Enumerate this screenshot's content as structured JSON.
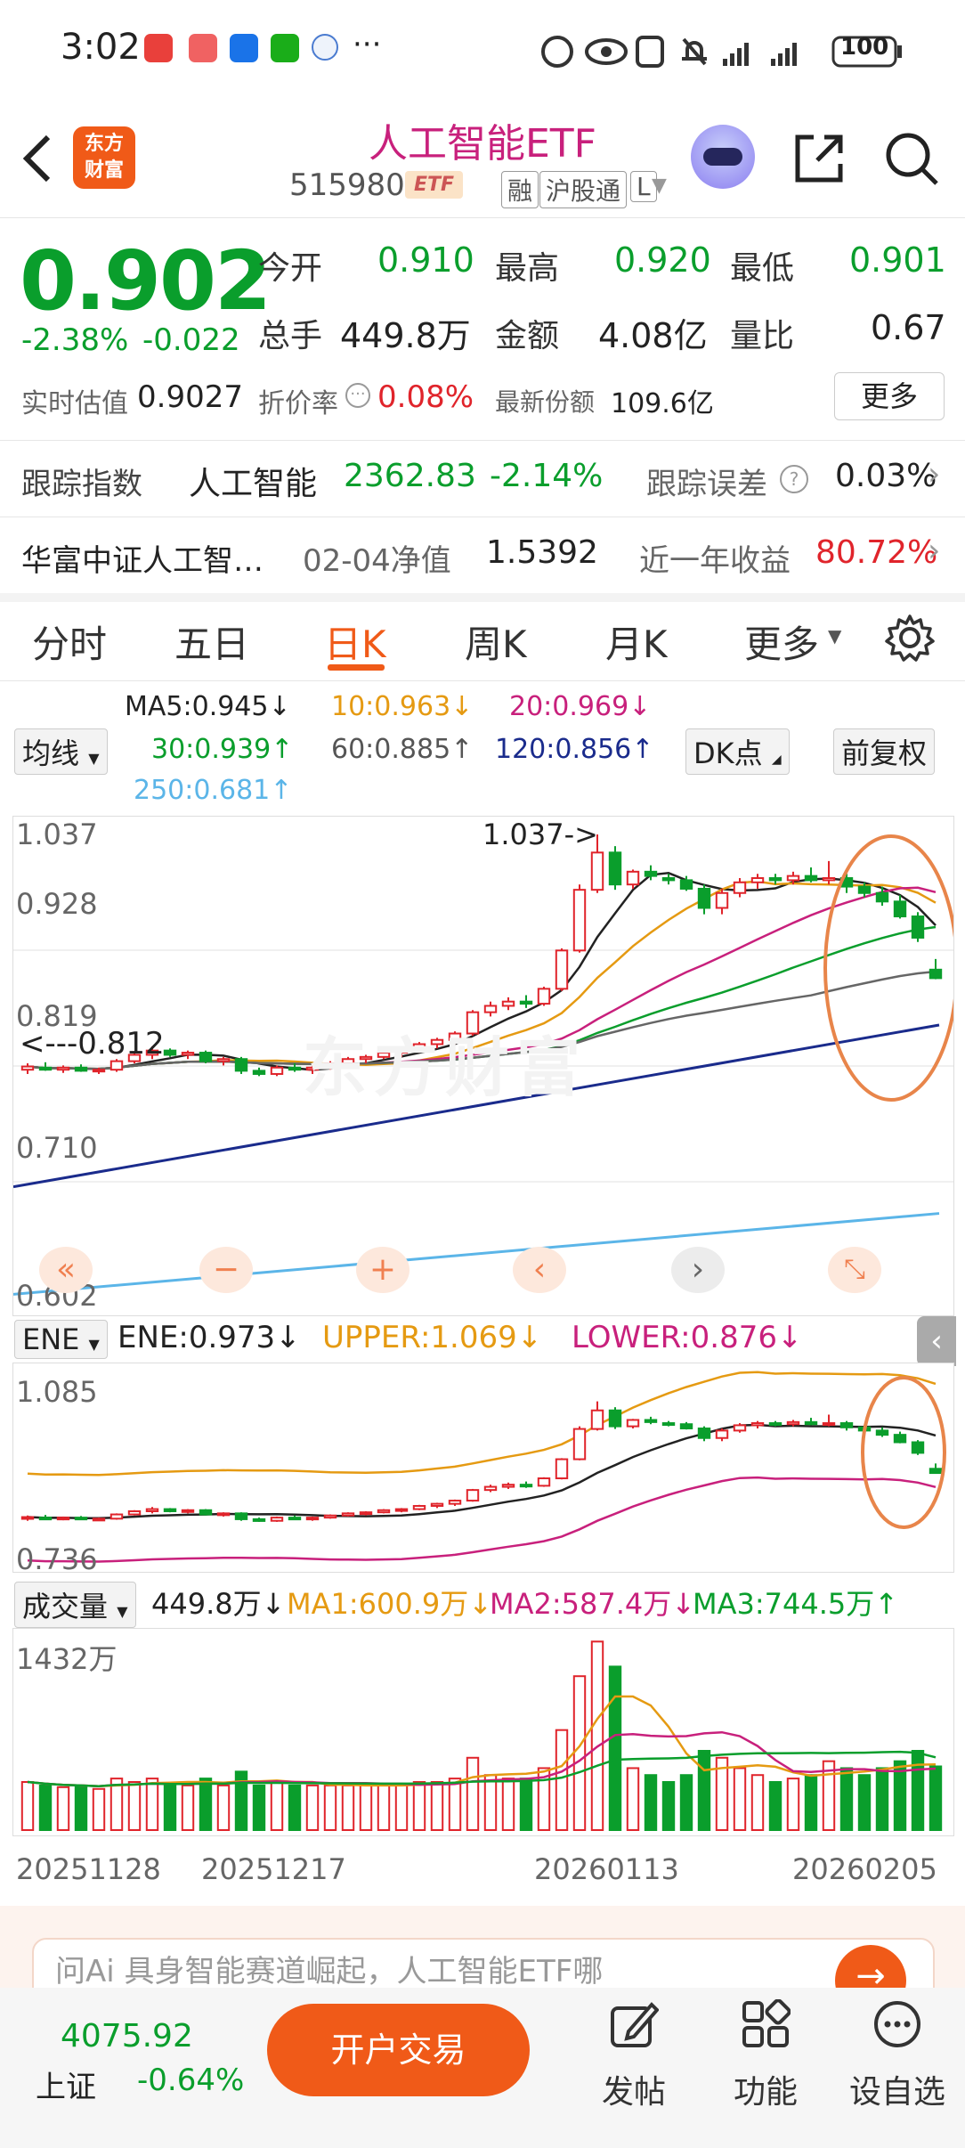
{
  "status_bar": {
    "time": "3:02",
    "dots": "···",
    "battery": "100"
  },
  "header": {
    "logo_text_1": "东方",
    "logo_text_2": "财富",
    "title": "人工智能ETF",
    "code": "515980",
    "etf_badge": "ETF",
    "tags": [
      "融",
      "沪股通",
      "L"
    ]
  },
  "quote": {
    "price": "0.902",
    "change_pct": "-2.38%",
    "change": "-0.022",
    "open_label": "今开",
    "open": "0.910",
    "high_label": "最高",
    "high": "0.920",
    "low_label": "最低",
    "low": "0.901",
    "volume_label": "总手",
    "volume": "449.8万",
    "amount_label": "金额",
    "amount": "4.08亿",
    "ratio_label": "量比",
    "ratio": "0.67",
    "est_label": "实时估值",
    "est": "0.9027",
    "premium_label": "折价率",
    "premium": "0.08%",
    "shares_label": "最新份额",
    "shares": "109.6亿",
    "more": "更多"
  },
  "tracking": {
    "label": "跟踪指数",
    "index": "人工智能",
    "value": "2362.83",
    "pct": "-2.14%",
    "error_label": "跟踪误差",
    "error": "0.03%"
  },
  "fund": {
    "name": "华富中证人工智…",
    "nav_label": "02-04净值",
    "nav": "1.5392",
    "yield_label": "近一年收益",
    "yield": "80.72%"
  },
  "tabs": [
    "分时",
    "五日",
    "日K",
    "周K",
    "月K",
    "更多"
  ],
  "active_tab": "日K",
  "ma": {
    "selector": "均线",
    "ma5": "MA5:0.945↓",
    "ma10": "10:0.963↓",
    "ma20": "20:0.969↓",
    "ma30": "30:0.939↑",
    "ma60": "60:0.885↑",
    "ma120": "120:0.856↑",
    "ma250": "250:0.681↑",
    "dk": "DK点",
    "adjust": "前复权"
  },
  "main_chart": {
    "y_labels": [
      "1.037",
      "0.928",
      "0.819",
      "0.710",
      "0.602"
    ],
    "high_marker": "1.037->",
    "low_marker": "<---0.812",
    "watermark": "东方财富"
  },
  "ene": {
    "selector": "ENE",
    "ene": "ENE:0.973↓",
    "upper": "UPPER:1.069↓",
    "lower": "LOWER:0.876↓",
    "y_top": "1.085",
    "y_bottom": "0.736"
  },
  "volume": {
    "selector": "成交量",
    "vol": "449.8万↓",
    "ma1": "MA1:600.9万↓",
    "ma2": "MA2:587.4万↓",
    "ma3": "MA3:744.5万↑",
    "y_top": "1432万"
  },
  "dates": [
    "20251128",
    "20251217",
    "20260113",
    "20260205"
  ],
  "bottom": {
    "index_value": "4075.92",
    "index_name": "上证",
    "index_pct": "-0.64%",
    "open_account": "开户交易",
    "nav": [
      "发帖",
      "功能",
      "设自选"
    ],
    "ai_banner": "问Ai  具身智能赛道崛起，人工智能ETF哪"
  },
  "colors": {
    "red": "#e0242b",
    "green": "#0a9e2c",
    "accent": "#f05a18",
    "title": "#c8207c"
  },
  "chart_data": {
    "type": "candlestick",
    "y_range": [
      0.602,
      1.037
    ],
    "ohlc": [
      [
        0.816,
        0.822,
        0.812,
        0.819
      ],
      [
        0.818,
        0.823,
        0.815,
        0.816
      ],
      [
        0.816,
        0.82,
        0.813,
        0.818
      ],
      [
        0.818,
        0.821,
        0.814,
        0.815
      ],
      [
        0.815,
        0.818,
        0.812,
        0.816
      ],
      [
        0.816,
        0.826,
        0.814,
        0.824
      ],
      [
        0.824,
        0.832,
        0.822,
        0.83
      ],
      [
        0.83,
        0.838,
        0.826,
        0.834
      ],
      [
        0.834,
        0.836,
        0.828,
        0.83
      ],
      [
        0.83,
        0.834,
        0.826,
        0.832
      ],
      [
        0.832,
        0.834,
        0.822,
        0.824
      ],
      [
        0.824,
        0.828,
        0.82,
        0.826
      ],
      [
        0.826,
        0.828,
        0.812,
        0.815
      ],
      [
        0.815,
        0.818,
        0.81,
        0.812
      ],
      [
        0.812,
        0.82,
        0.81,
        0.818
      ],
      [
        0.818,
        0.822,
        0.814,
        0.816
      ],
      [
        0.816,
        0.82,
        0.812,
        0.818
      ],
      [
        0.818,
        0.824,
        0.816,
        0.822
      ],
      [
        0.822,
        0.828,
        0.82,
        0.826
      ],
      [
        0.826,
        0.83,
        0.822,
        0.828
      ],
      [
        0.828,
        0.834,
        0.826,
        0.832
      ],
      [
        0.832,
        0.836,
        0.828,
        0.834
      ],
      [
        0.834,
        0.842,
        0.832,
        0.84
      ],
      [
        0.84,
        0.846,
        0.836,
        0.844
      ],
      [
        0.844,
        0.852,
        0.84,
        0.85
      ],
      [
        0.85,
        0.872,
        0.848,
        0.87
      ],
      [
        0.87,
        0.88,
        0.866,
        0.876
      ],
      [
        0.876,
        0.884,
        0.872,
        0.88
      ],
      [
        0.88,
        0.886,
        0.874,
        0.878
      ],
      [
        0.878,
        0.894,
        0.876,
        0.892
      ],
      [
        0.892,
        0.93,
        0.89,
        0.928
      ],
      [
        0.928,
        0.99,
        0.926,
        0.985
      ],
      [
        0.985,
        1.037,
        0.982,
        1.02
      ],
      [
        1.02,
        1.026,
        0.985,
        0.99
      ],
      [
        0.99,
        1.004,
        0.986,
        1.002
      ],
      [
        1.002,
        1.008,
        0.994,
        0.998
      ],
      [
        0.996,
        1.0,
        0.99,
        0.994
      ],
      [
        0.994,
        0.998,
        0.984,
        0.986
      ],
      [
        0.986,
        0.99,
        0.962,
        0.968
      ],
      [
        0.968,
        0.986,
        0.962,
        0.982
      ],
      [
        0.982,
        0.996,
        0.978,
        0.992
      ],
      [
        0.992,
        1.0,
        0.986,
        0.996
      ],
      [
        0.996,
        1.0,
        0.99,
        0.994
      ],
      [
        0.994,
        1.002,
        0.99,
        0.998
      ],
      [
        0.998,
        1.006,
        0.992,
        0.994
      ],
      [
        0.994,
        1.012,
        0.99,
        0.996
      ],
      [
        0.996,
        1.0,
        0.982,
        0.988
      ],
      [
        0.988,
        0.992,
        0.978,
        0.982
      ],
      [
        0.982,
        0.988,
        0.97,
        0.974
      ],
      [
        0.974,
        0.98,
        0.958,
        0.96
      ],
      [
        0.96,
        0.964,
        0.936,
        0.94
      ],
      [
        0.91,
        0.92,
        0.901,
        0.902
      ]
    ],
    "volume_max": "1432万"
  }
}
